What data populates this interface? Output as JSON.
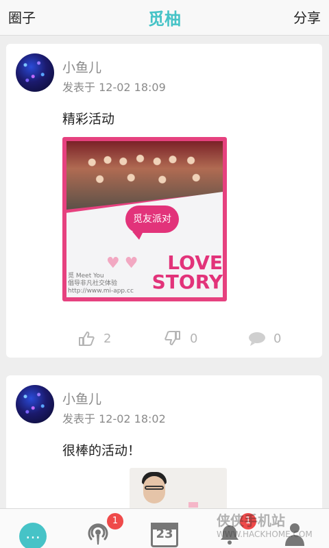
{
  "header": {
    "left_label": "圈子",
    "title": "觅柚",
    "right_label": "分享"
  },
  "posts": [
    {
      "username": "小鱼儿",
      "timestamp": "发表于 12-02 18:09",
      "text": "精彩活动",
      "image": {
        "bubble_text": "觅友派对",
        "meet_lines": [
          "觅 Meet You",
          "倡导非凡社交体验",
          "http://www.mi-app.cc"
        ],
        "love_line1": "LOVE",
        "love_line2": "STORY"
      },
      "likes": "2",
      "dislikes": "0",
      "comments": "0"
    },
    {
      "username": "小鱼儿",
      "timestamp": "发表于 12-02 18:02",
      "text": "很棒的活动！"
    }
  ],
  "tabbar": {
    "badge_podcast": "1",
    "calendar_day": "23",
    "badge_tab4": "1"
  },
  "watermark": {
    "brand": "侠侠手机站",
    "url": "WWW.HACKHOME.COM"
  },
  "colors": {
    "accent": "#46c3c7",
    "badge": "#ef4a4a",
    "pink": "#e2337a"
  }
}
